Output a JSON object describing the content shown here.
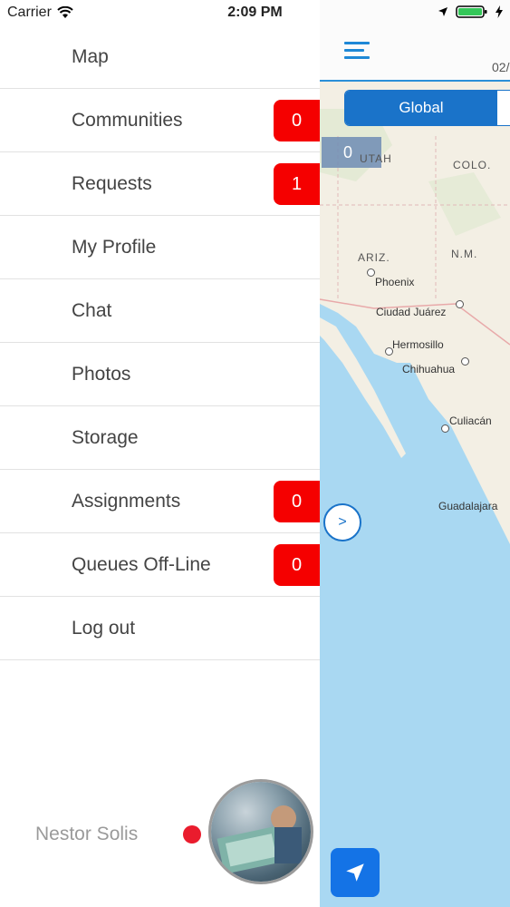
{
  "status_bar": {
    "carrier": "Carrier",
    "time": "2:09 PM"
  },
  "map": {
    "header_date": "02/",
    "segment": {
      "selected": "Global"
    },
    "overlay_count": "0",
    "regions": [
      "UTAH",
      "COLO.",
      "ARIZ.",
      "N.M."
    ],
    "cities": [
      "Phoenix",
      "Ciudad Juárez",
      "Hermosillo",
      "Chihuahua",
      "Culiacán",
      "Guadalajara"
    ],
    "drawer_toggle": ">"
  },
  "menu": {
    "items": [
      {
        "label": "Map"
      },
      {
        "label": "Communities",
        "badge": "0"
      },
      {
        "label": "Requests",
        "badge": "1"
      },
      {
        "label": "My Profile"
      },
      {
        "label": "Chat"
      },
      {
        "label": "Photos"
      },
      {
        "label": "Storage"
      },
      {
        "label": "Assignments",
        "badge": "0"
      },
      {
        "label": "Queues Off-Line",
        "badge": "0"
      },
      {
        "label": "Log out"
      }
    ]
  },
  "user": {
    "name": "Nestor Solis",
    "status_color": "#ea1c2d"
  },
  "colors": {
    "accent": "#1a73c9",
    "badge": "#f50000",
    "water": "#a9d8f2"
  }
}
